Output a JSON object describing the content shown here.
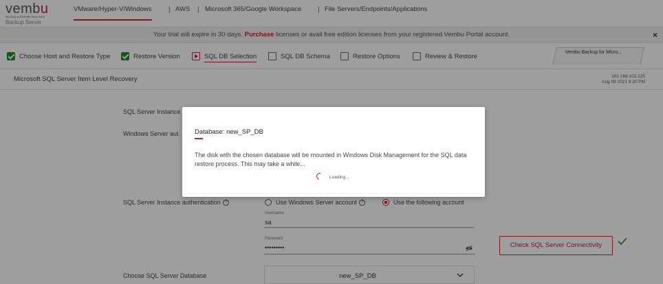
{
  "brand": {
    "name_a": "vemb",
    "name_b": "u",
    "tagline": "Backup & Disaster Recovery",
    "product": "Backup Server"
  },
  "nav": {
    "tabs": [
      {
        "label": "VMware/Hyper-V/Windows",
        "active": true
      },
      {
        "label": "AWS"
      },
      {
        "label": "Microsoft 365/Google Workspace"
      },
      {
        "label": "File Servers/Endpoints/Applications"
      }
    ],
    "separator": "|"
  },
  "banner": {
    "text_before": "Your trial will expire in 30 days.",
    "purchase": "Purchase",
    "text_after": "licenses or avail free edition licenses from your registered Vembu Portal account.",
    "close": "×"
  },
  "steps": [
    {
      "label": "Choose Host and Restore Type",
      "state": "done"
    },
    {
      "label": "Restore Version",
      "state": "done"
    },
    {
      "label": "SQL DB Selection",
      "state": "current"
    },
    {
      "label": "SQL DB Schema",
      "state": "pending"
    },
    {
      "label": "Restore Options",
      "state": "pending"
    },
    {
      "label": "Review & Restore",
      "state": "pending"
    }
  ],
  "server_tab": "Vembu Backup for Micro...",
  "section": {
    "title": "Microsoft SQL Server Item Level Recovery",
    "ip": "192.168.102.125",
    "datetime": "Aug 09 2021 6:30 PM"
  },
  "form": {
    "sql_instance_label": "SQL Server Instance",
    "windows_auth_label": "Windows Server aut",
    "sql_auth_label": "SQL Server Instance authentication",
    "help_glyph": "?",
    "option_windows": "Use Windows Server account",
    "option_following": "Use the following account",
    "username_label": "Username",
    "username_value": "sa",
    "password_label": "Password",
    "password_value": "•••••••••",
    "check_button": "Check SQL Server Connectivity",
    "database_label": "Choose SQL Server Database",
    "database_value": "new_SP_DB"
  },
  "modal": {
    "title": "Database: new_SP_DB",
    "body": "The disk with the chosen database will be mounted in Windows Disk Management for the SQL data restore process. This may take a while...",
    "loading": "Loading..."
  },
  "colors": {
    "accent": "#d0202e",
    "success": "#1f8a2e"
  }
}
